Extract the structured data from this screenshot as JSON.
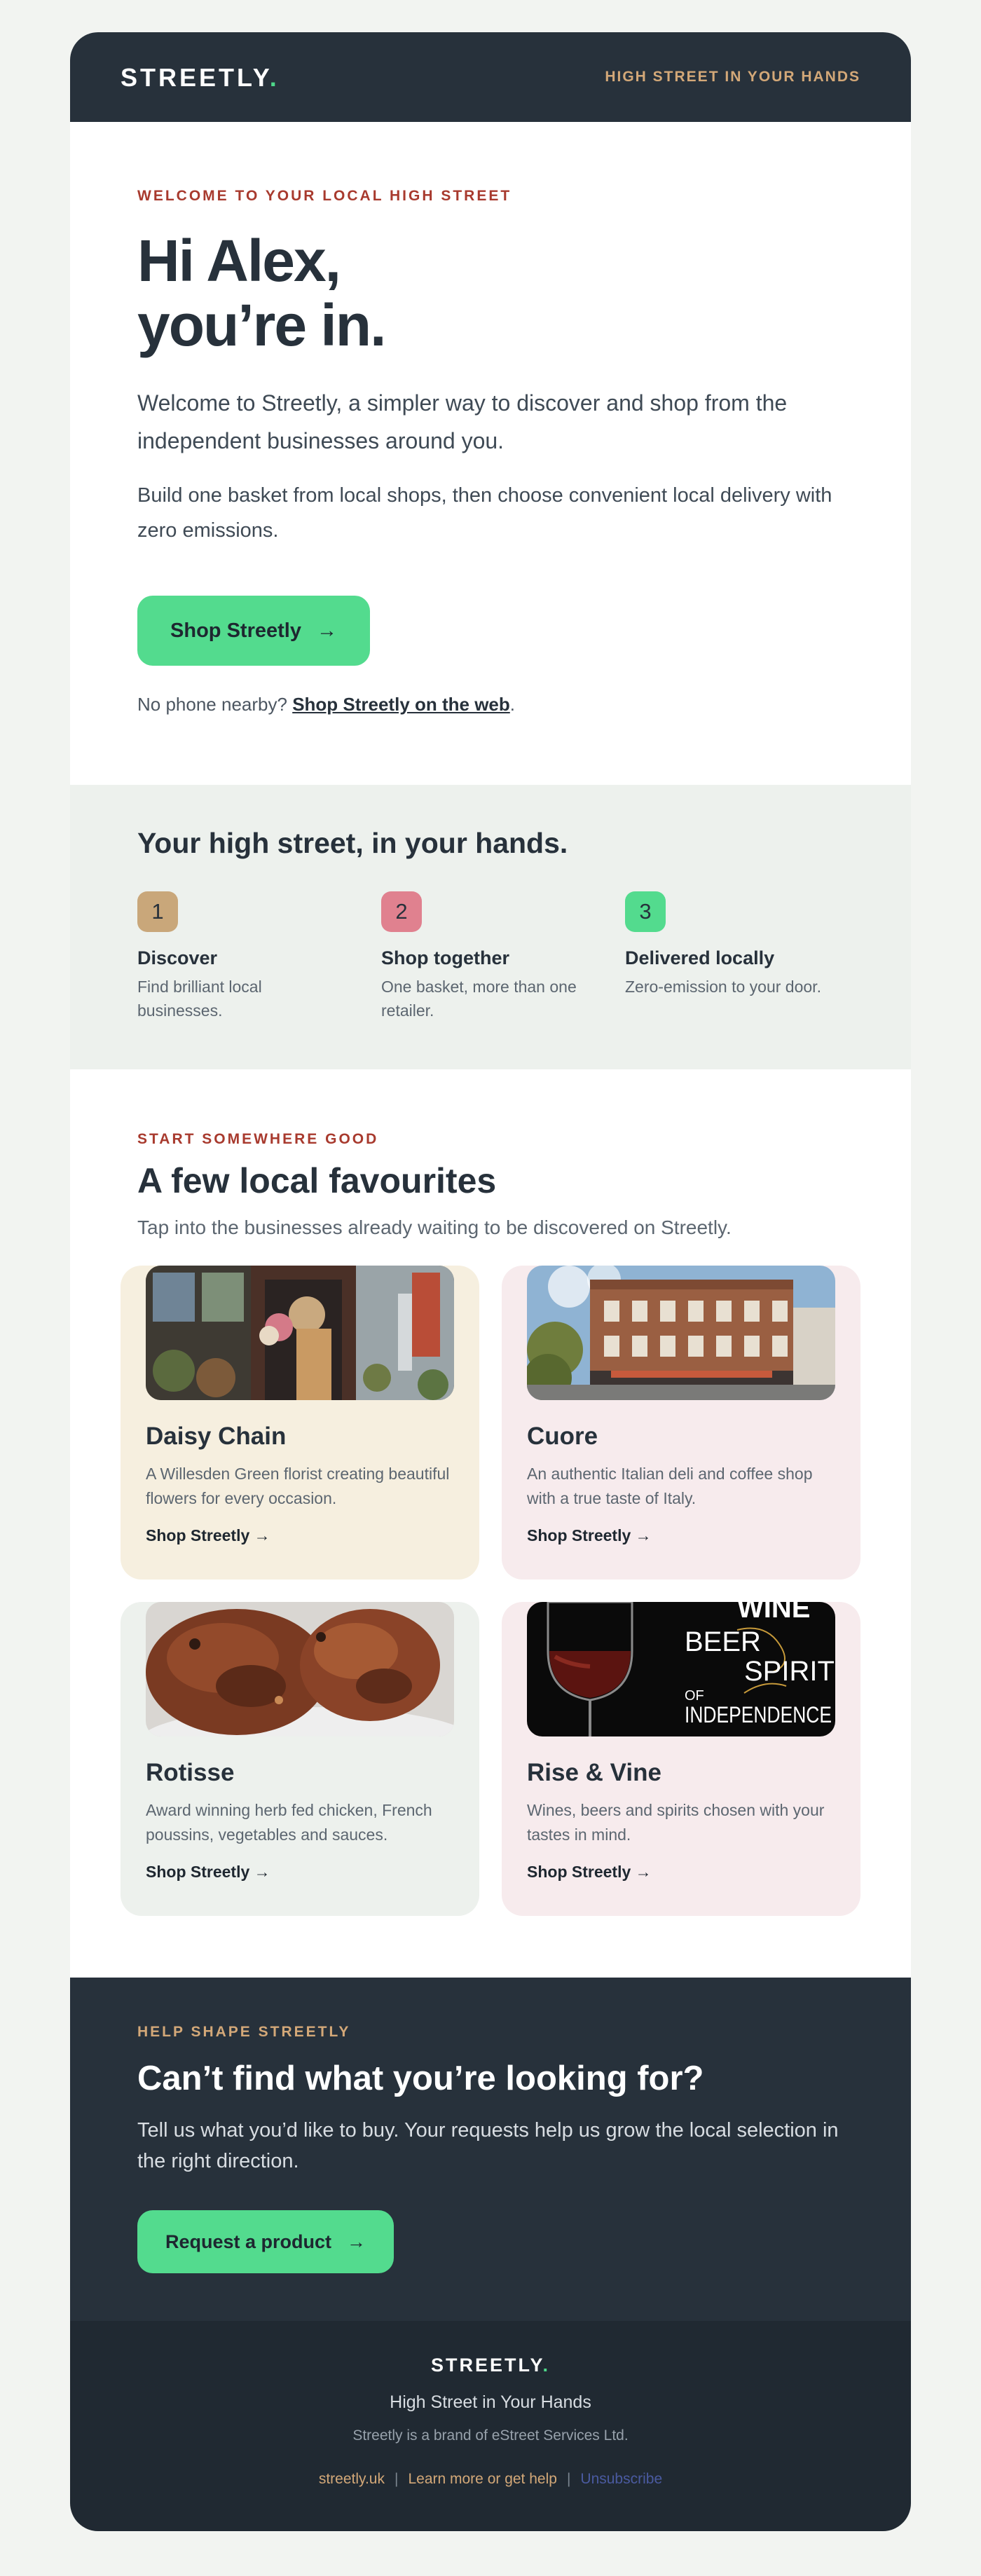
{
  "header": {
    "logo": "STREETLY",
    "logo_dot": ".",
    "tagline": "HIGH STREET IN YOUR HANDS"
  },
  "hero": {
    "eyebrow": "WELCOME TO YOUR LOCAL HIGH STREET",
    "title_line1": "Hi Alex,",
    "title_line2": "you’re in.",
    "lead": "Welcome to Streetly, a simpler way to discover and shop from the independent businesses around you.",
    "sub": "Build one basket from local shops, then choose convenient local delivery with zero emissions.",
    "cta_label": "Shop Streetly",
    "cta_arrow": "→",
    "nophone_prefix": "No phone nearby?",
    "nophone_link": "Shop Streetly on the web",
    "nophone_suffix": "."
  },
  "steps": {
    "title": "Your high street, in your hands.",
    "items": [
      {
        "num": "1",
        "title": "Discover",
        "desc": "Find brilliant local businesses.",
        "color": "#c9a77a"
      },
      {
        "num": "2",
        "title": "Shop together",
        "desc": "One basket, more than one retailer.",
        "color": "#e0818f"
      },
      {
        "num": "3",
        "title": "Delivered locally",
        "desc": "Zero-emission to your door.",
        "color": "#53db8e"
      }
    ]
  },
  "favourites": {
    "eyebrow": "START SOMEWHERE GOOD",
    "title": "A few local favourites",
    "subtitle": "Tap into the businesses already waiting to be discovered on Streetly.",
    "shops": [
      {
        "name": "Daisy Chain",
        "desc": "A Willesden Green florist creating beautiful flowers for every occasion.",
        "link": "Shop Streetly",
        "arrow": "→",
        "bg": "#f6efdf"
      },
      {
        "name": "Cuore",
        "desc": "An authentic Italian deli and coffee shop with a true taste of Italy.",
        "link": "Shop Streetly",
        "arrow": "→",
        "bg": "#f7ebed"
      },
      {
        "name": "Rotisse",
        "desc": "Award winning herb fed chicken, French poussins, vegetables and sauces.",
        "link": "Shop Streetly",
        "arrow": "→",
        "bg": "#edf1ed"
      },
      {
        "name": "Rise & Vine",
        "desc": "Wines, beers and spirits chosen with your tastes in mind.",
        "link": "Shop Streetly",
        "arrow": "→",
        "bg": "#f7ebed"
      }
    ],
    "wine_poster": {
      "line1": "WINE",
      "line2": "BEER",
      "line3": "SPIRIT",
      "line4a": "OF",
      "line4b": "INDEPENDENCE"
    }
  },
  "help": {
    "eyebrow": "HELP SHAPE STREETLY",
    "title": "Can’t find what you’re looking for?",
    "text": "Tell us what you’d like to buy. Your requests help us grow the local selection in the right direction.",
    "cta_label": "Request a product",
    "cta_arrow": "→"
  },
  "footer": {
    "logo": "STREETLY",
    "logo_dot": ".",
    "tagline": "High Street in Your Hands",
    "brand": "Streetly is a brand of eStreet Services Ltd.",
    "link1": "streetly.uk",
    "link2": "Learn more or get help",
    "link3": "Unsubscribe",
    "separator": "|"
  },
  "colors": {
    "accent": "#53db8e",
    "dark": "#27313b",
    "eyebrow": "#a83a2e",
    "gold": "#d3a878"
  }
}
